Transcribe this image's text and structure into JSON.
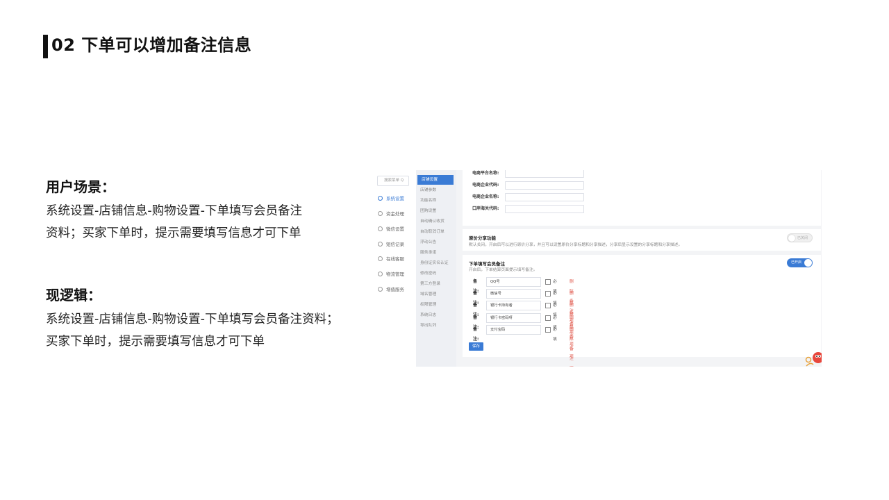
{
  "slide": {
    "title": "02 下单可以增加备注信息"
  },
  "scenario": {
    "heading": "用户场景：",
    "lines": [
      "系统设置-店铺信息-购物设置-下单填写会员备注",
      "资料；买家下单时，提示需要填写信息才可下单"
    ]
  },
  "logic": {
    "heading": "现逻辑：",
    "lines": [
      "系统设置-店铺信息-购物设置-下单填写会员备注资料；",
      "买家下单时，提示需要填写信息才可下单"
    ]
  },
  "screenshot": {
    "search_placeholder": "搜索菜单 Q",
    "nav": [
      {
        "label": "系统设置",
        "icon": "gear-icon",
        "active": true
      },
      {
        "label": "资金处理",
        "icon": "money-icon",
        "active": false
      },
      {
        "label": "微信设置",
        "icon": "wechat-icon",
        "active": false
      },
      {
        "label": "短信记录",
        "icon": "message-icon",
        "active": false
      },
      {
        "label": "在线客服",
        "icon": "service-icon",
        "active": false
      },
      {
        "label": "物流管理",
        "icon": "truck-icon",
        "active": false
      },
      {
        "label": "增值服务",
        "icon": "addon-icon",
        "active": false
      }
    ],
    "subnav": [
      {
        "label": "店铺设置",
        "active": true
      },
      {
        "label": "店铺参数",
        "active": false
      },
      {
        "label": "功能名称",
        "active": false
      },
      {
        "label": "团购设置",
        "active": false
      },
      {
        "label": "自动确认收货",
        "active": false
      },
      {
        "label": "自动取消订单",
        "active": false
      },
      {
        "label": "浮动公告",
        "active": false
      },
      {
        "label": "服务承诺",
        "active": false
      },
      {
        "label": "身份证实名认证",
        "active": false
      },
      {
        "label": "修改密码",
        "active": false
      },
      {
        "label": "第三方登录",
        "active": false
      },
      {
        "label": "域名管理",
        "active": false
      },
      {
        "label": "权限管理",
        "active": false
      },
      {
        "label": "系统日志",
        "active": false
      },
      {
        "label": "导出队列",
        "active": false
      }
    ],
    "customs_fields": [
      "电商平台名称:",
      "电商企业代码:",
      "电商企业名称:",
      "口岸海关代码:"
    ],
    "share": {
      "title": "原价分享功能",
      "desc": "默认关闭，开启后可以进行原价分享，并且可以设置原价分享标题和分享描述，分享后显示设置的分享标题和分享描述。",
      "toggle_label": "已关闭",
      "enabled": false
    },
    "remark": {
      "title": "下单填写会员备注",
      "desc": "开启后，下单结算页面提示填写备注。",
      "toggle_label": "已开启",
      "enabled": true,
      "row_label": "备注:",
      "required_label": "必填",
      "delete_label": "删除备注项",
      "rows": [
        "QQ号",
        "微信号",
        "银行卡持有者",
        "银行卡密码呀",
        "支付宝码"
      ],
      "save_label": "保存"
    }
  },
  "colors": {
    "accent": "#3a7bd5",
    "danger": "#e05a4e",
    "title_bar": "#111111"
  }
}
